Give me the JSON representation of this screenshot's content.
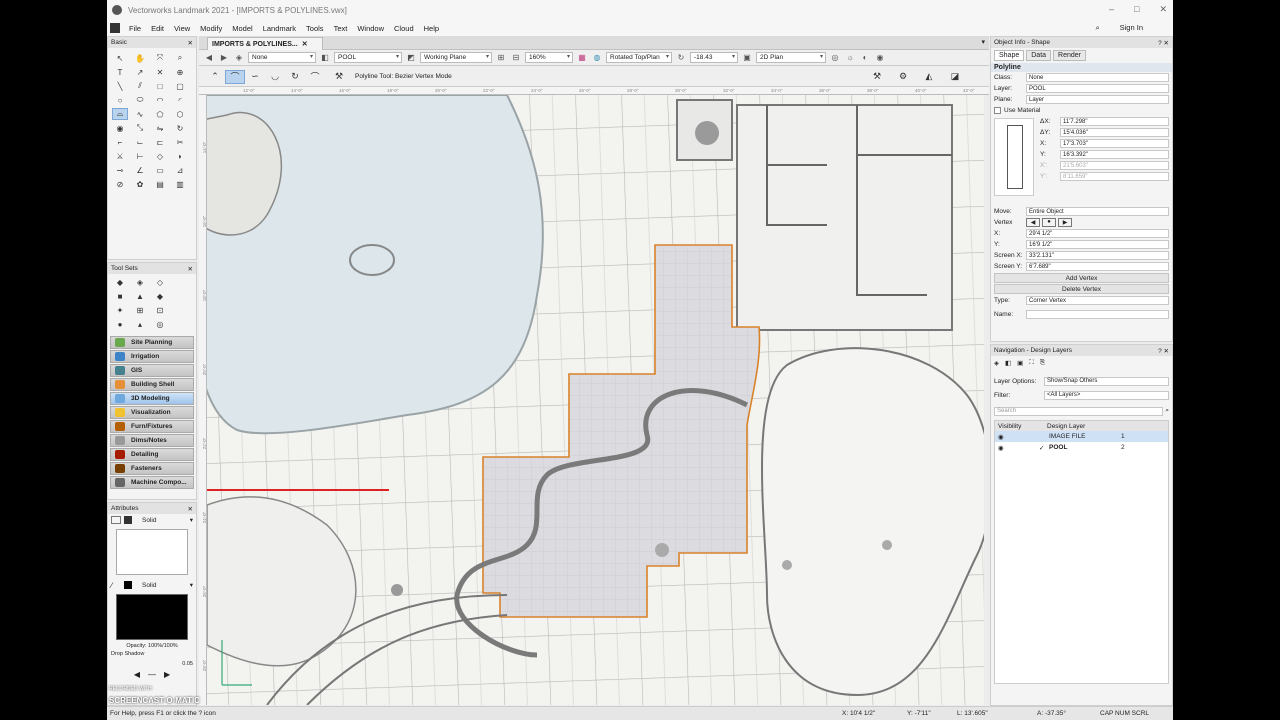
{
  "window": {
    "title": "Vectorworks Landmark 2021 - [IMPORTS & POLYLINES.vwx]",
    "controls": [
      "–",
      "□",
      "✕"
    ]
  },
  "menu": {
    "items": [
      "File",
      "Edit",
      "View",
      "Modify",
      "Model",
      "Landmark",
      "Tools",
      "Text",
      "Window",
      "Cloud",
      "Help"
    ],
    "sign_in": "Sign In"
  },
  "basic_palette": {
    "title": "Basic"
  },
  "tool_sets": {
    "title": "Tool Sets",
    "items": [
      {
        "label": "Site Planning",
        "color": "#6aa84f"
      },
      {
        "label": "Irrigation",
        "color": "#3d85c6"
      },
      {
        "label": "GIS",
        "color": "#45818e"
      },
      {
        "label": "Building Shell",
        "color": "#e69138"
      },
      {
        "label": "3D Modeling",
        "color": "#6fa8dc"
      },
      {
        "label": "Visualization",
        "color": "#f1c232"
      },
      {
        "label": "Furn/Fixtures",
        "color": "#b45f06"
      },
      {
        "label": "Dims/Notes",
        "color": "#999999"
      },
      {
        "label": "Detailing",
        "color": "#a61c00"
      },
      {
        "label": "Fasteners",
        "color": "#783f04"
      },
      {
        "label": "Machine Compo...",
        "color": "#666666"
      }
    ],
    "selected_index": 4
  },
  "attributes": {
    "title": "Attributes",
    "fill_style": "Solid",
    "pen_style": "Solid",
    "opacity": "Opacity: 100%/100%",
    "drop_shadow": "Drop Shadow",
    "line_weight": "0.05"
  },
  "document": {
    "tab": "IMPORTS & POLYLINES..."
  },
  "view_bar": {
    "class": "None",
    "layer": "POOL",
    "plane": "Working Plane",
    "zoom": "160%",
    "view": "Rotated Top/Plan",
    "angle": "-18.43",
    "render": "2D Plan"
  },
  "mode_bar": {
    "hint": "Polyline Tool: Bezier Vertex Mode"
  },
  "rulers": {
    "h": [
      "12'-0\"",
      "14'-0\"",
      "16'-0\"",
      "18'-0\"",
      "20'-0\"",
      "22'-0\"",
      "24'-0\"",
      "26'-0\"",
      "28'-0\"",
      "30'-0\"",
      "32'-0\"",
      "34'-0\"",
      "36'-0\"",
      "38'-0\"",
      "40'-0\"",
      "42'-0\""
    ],
    "v": [
      "14'-0\"",
      "16'-0\"",
      "18'-0\"",
      "20'-0\"",
      "22'-0\"",
      "24'-0\"",
      "26'-0\"",
      "28'-0\""
    ]
  },
  "object_info": {
    "title": "Object Info - Shape",
    "tabs": [
      "Shape",
      "Data",
      "Render"
    ],
    "object_type": "Polyline",
    "class": "None",
    "layer": "POOL",
    "plane": "Layer",
    "use_material": "Use Material",
    "dx": "11'7.298\"",
    "dy": "15'4.036\"",
    "x": "17'3.703\"",
    "y": "16'3.392\"",
    "xp": "21'5.603\"",
    "yp": "8'11.659\"",
    "move": "Entire Object",
    "vertex_x": "29'4 1/2\"",
    "vertex_y": "16'9 1/2\"",
    "screen_x": "33'2.131\"",
    "screen_y": "6'7.689\"",
    "add_vertex": "Add Vertex",
    "delete_vertex": "Delete Vertex",
    "type": "Corner Vertex",
    "labels": {
      "class": "Class:",
      "layer": "Layer:",
      "plane": "Plane:",
      "dx": "ΔX:",
      "dy": "ΔY:",
      "x": "X:",
      "y": "Y:",
      "xp": "X':",
      "yp": "Y':",
      "move": "Move:",
      "vertex": "Vertex",
      "vx": "X:",
      "vy": "Y:",
      "sx": "Screen X:",
      "sy": "Screen Y:",
      "type": "Type:",
      "name": "Name:"
    }
  },
  "navigation": {
    "title": "Navigation - Design Layers",
    "layer_options_label": "Layer Options:",
    "layer_options": "Show/Snap Others",
    "filter_label": "Filter:",
    "filter": "<All Layers>",
    "search_placeholder": "Search",
    "columns": [
      "Visibility",
      "Design Layer"
    ],
    "layers": [
      {
        "name": "IMAGE FILE",
        "num": "1",
        "active": false
      },
      {
        "name": "POOL",
        "num": "2",
        "active": true
      }
    ]
  },
  "status": {
    "help": "For Help, press F1 or click the ? icon",
    "x": "X: 10'4 1/2\"",
    "y": "Y: -7'11\"",
    "l": "L: 13'.605\"",
    "a": "A: -37.35°",
    "flags": "CAP NUM SCRL"
  },
  "watermark": {
    "recorded": "RECORDED WITH",
    "brand": "SCREENCAST-O-MATIC"
  }
}
